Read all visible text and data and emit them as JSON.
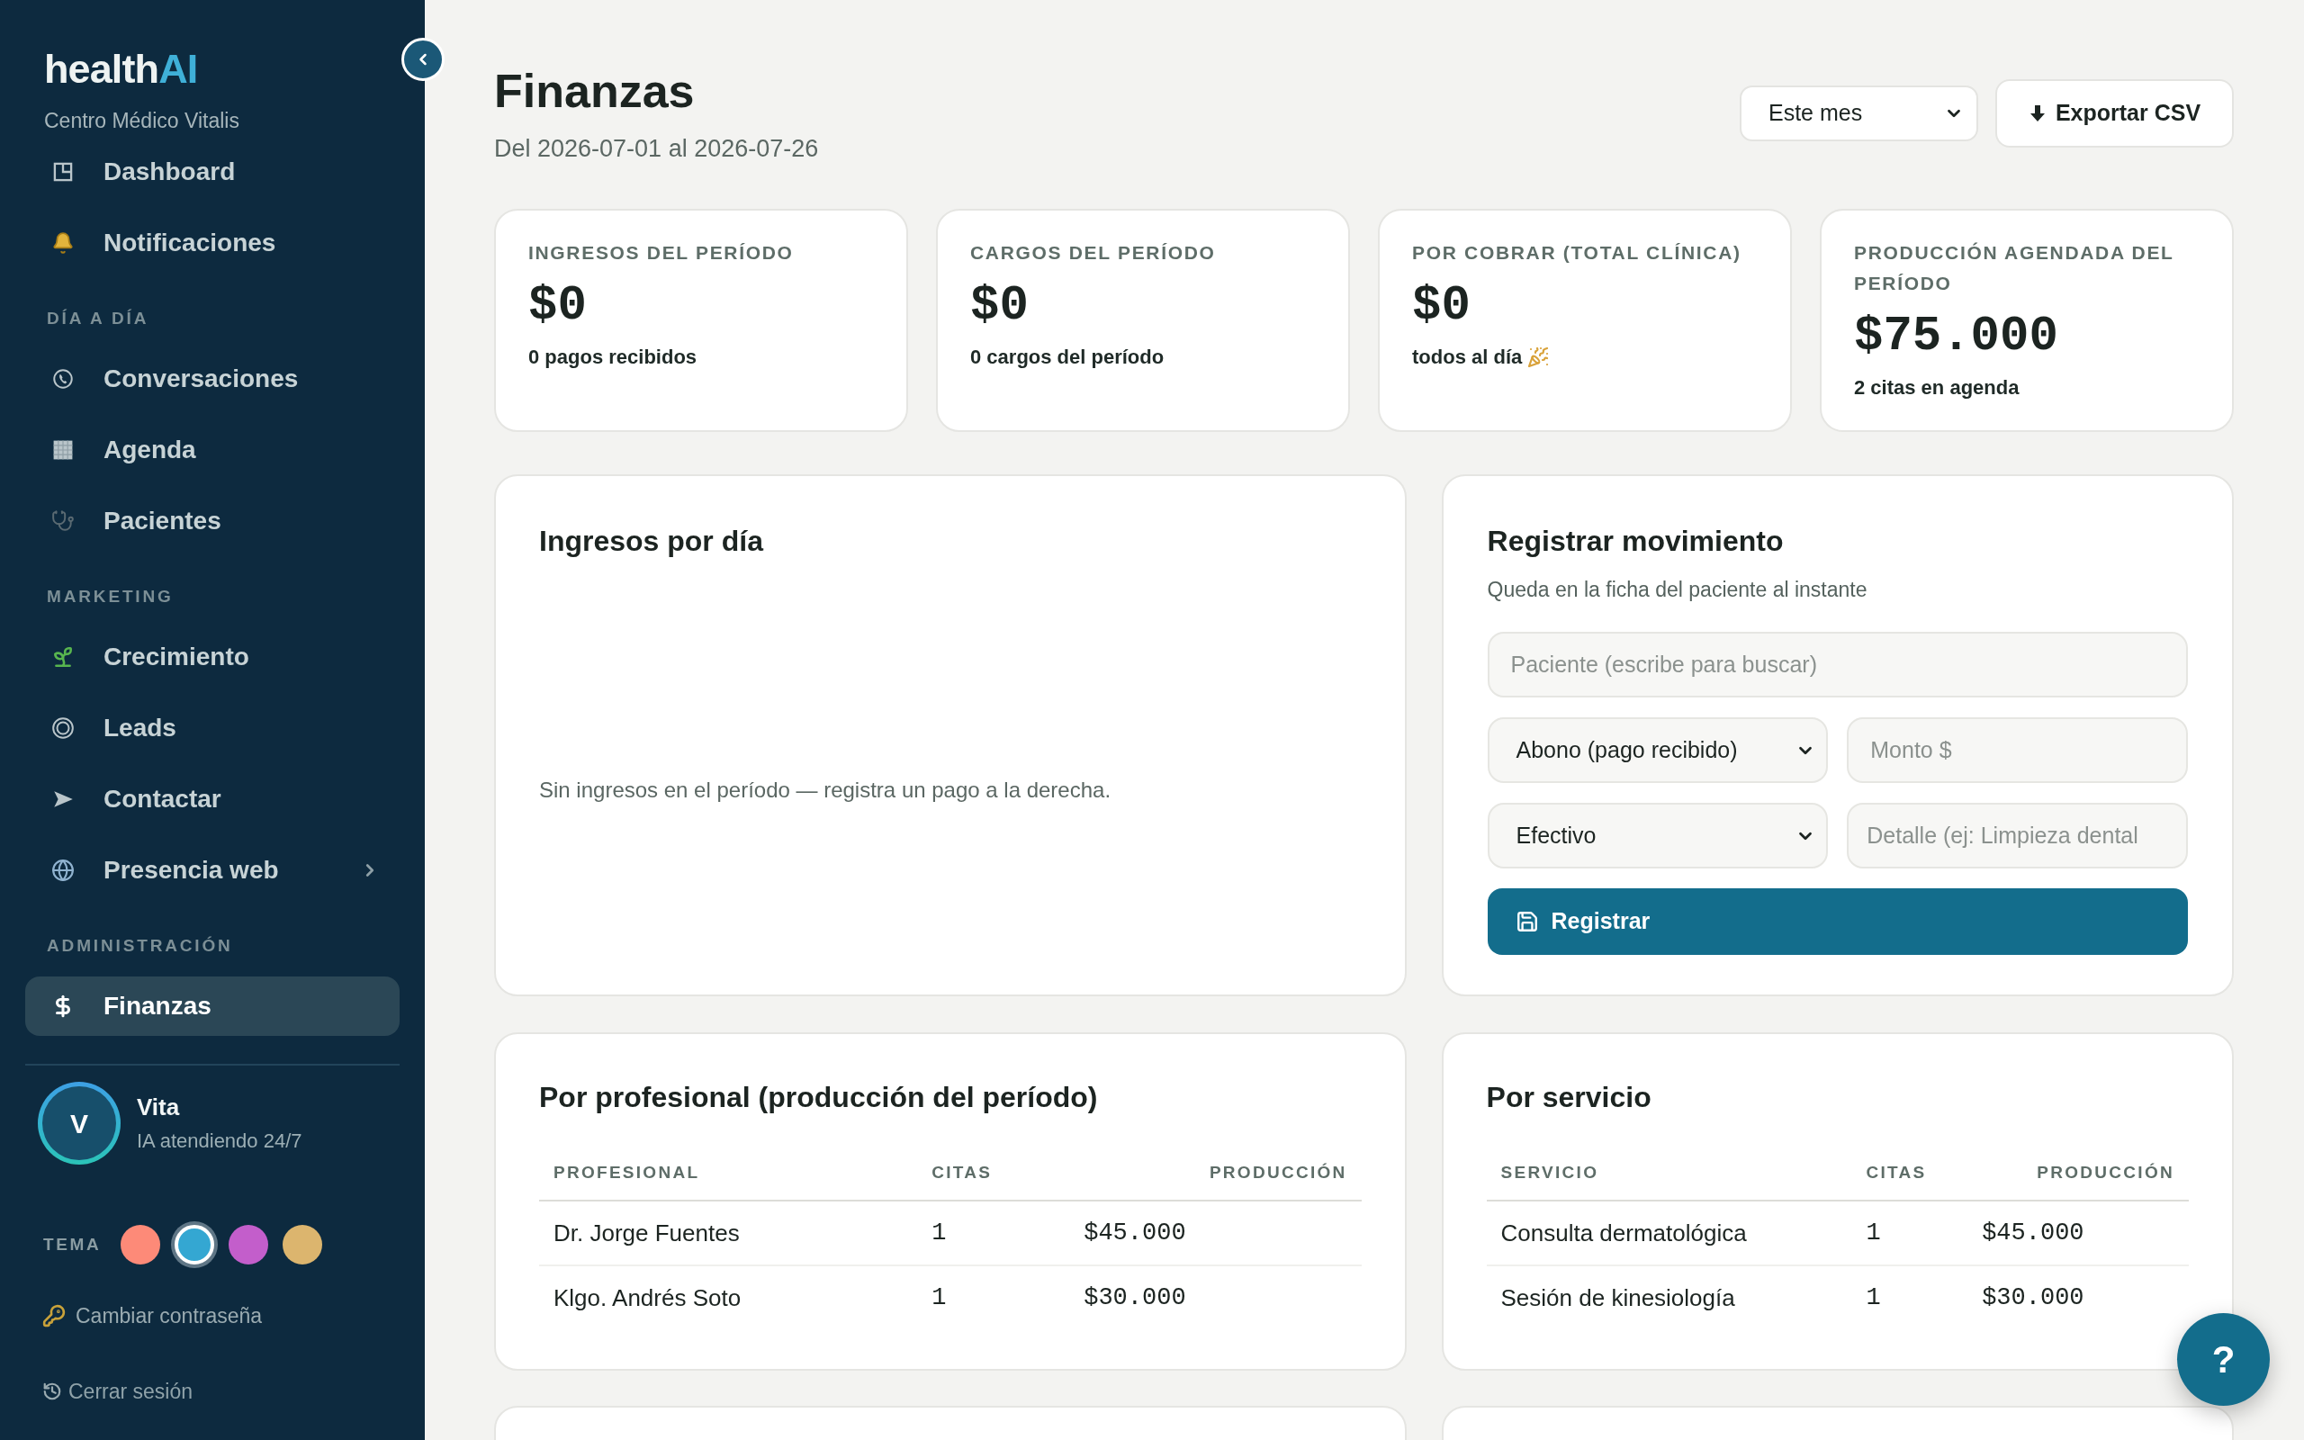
{
  "sidebar": {
    "logo": {
      "text": "health",
      "accent": "AI"
    },
    "clinic_name": "Centro Médico Vitalis",
    "sections": [
      {
        "items": [
          {
            "label": "Dashboard",
            "selected": false,
            "submenu": false
          },
          {
            "label": "Notificaciones",
            "selected": false,
            "submenu": false
          }
        ]
      },
      {
        "title": "DÍA A DÍA",
        "items": [
          {
            "label": "Conversaciones",
            "selected": false,
            "submenu": false
          },
          {
            "label": "Agenda",
            "selected": false,
            "submenu": false
          },
          {
            "label": "Pacientes",
            "selected": false,
            "submenu": false
          }
        ]
      },
      {
        "title": "MARKETING",
        "items": [
          {
            "label": "Crecimiento",
            "selected": false,
            "submenu": false
          },
          {
            "label": "Leads",
            "selected": false,
            "submenu": false
          },
          {
            "label": "Contactar",
            "selected": false,
            "submenu": false
          },
          {
            "label": "Presencia web",
            "selected": false,
            "submenu": true
          }
        ]
      },
      {
        "title": "ADMINISTRACIÓN",
        "items": [
          {
            "label": "Finanzas",
            "selected": true,
            "submenu": false
          }
        ]
      }
    ],
    "assistant": {
      "initial": "V",
      "name": "Vita",
      "status": "IA atendiendo 24/7"
    },
    "theme": {
      "label": "TEMA",
      "swatches": [
        {
          "color": "#fd8a78",
          "selected": false
        },
        {
          "color": "#34a7d2",
          "selected": true
        },
        {
          "color": "#c35ecb",
          "selected": false
        },
        {
          "color": "#dcb56e",
          "selected": false
        }
      ]
    },
    "links": [
      "Cambiar contraseña",
      "Cerrar sesión"
    ]
  },
  "header": {
    "title": "Finanzas",
    "date_range": "Del 2026-07-01 al 2026-07-26",
    "period_select": {
      "value": "Este mes"
    },
    "export_button": "Exportar CSV"
  },
  "stats": [
    {
      "label": "INGRESOS DEL PERÍODO",
      "value": "$0",
      "note": "0 pagos recibidos"
    },
    {
      "label": "CARGOS DEL PERÍODO",
      "value": "$0",
      "note": "0 cargos del período"
    },
    {
      "label": "POR COBRAR (TOTAL CLÍNICA)",
      "value": "$0",
      "note": "todos al día"
    },
    {
      "label": "PRODUCCIÓN AGENDADA DEL PERÍODO",
      "value": "$75.000",
      "note": "2 citas en agenda"
    }
  ],
  "income_by_day": {
    "title": "Ingresos por día",
    "empty_message": "Sin ingresos en el período — registra un pago a la derecha."
  },
  "register_movement": {
    "title": "Registrar movimiento",
    "subtitle": "Queda en la ficha del paciente al instante",
    "patient_field": {
      "placeholder": "Paciente (escribe para buscar)"
    },
    "type_select": {
      "value": "Abono (pago recibido)"
    },
    "amount_field": {
      "placeholder": "Monto $"
    },
    "method_select": {
      "value": "Efectivo"
    },
    "detail_field": {
      "placeholder": "Detalle (ej: Limpieza dental"
    },
    "submit_button": "Registrar"
  },
  "tables": [
    {
      "title": "Por profesional (producción del período)",
      "columns": [
        "PROFESIONAL",
        "CITAS",
        "PRODUCCIÓN"
      ],
      "rows": [
        [
          "Dr. Jorge Fuentes",
          "1",
          "$45.000"
        ],
        [
          "Klgo. Andrés Soto",
          "1",
          "$30.000"
        ]
      ]
    },
    {
      "title": "Por servicio",
      "columns": [
        "SERVICIO",
        "CITAS",
        "PRODUCCIÓN"
      ],
      "rows": [
        [
          "Consulta dermatológica",
          "1",
          "$45.000"
        ],
        [
          "Sesión de kinesiología",
          "1",
          "$30.000"
        ]
      ]
    }
  ],
  "help_button": "?"
}
